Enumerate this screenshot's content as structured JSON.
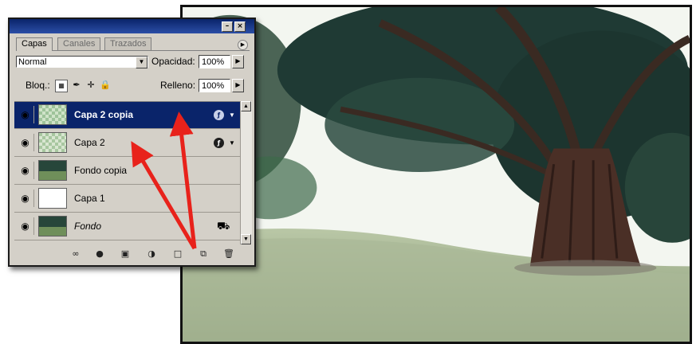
{
  "palette": {
    "title_buttons": [
      "–",
      "×"
    ],
    "tabs": [
      {
        "label": "Capas",
        "active": true
      },
      {
        "label": "Canales",
        "active": false
      },
      {
        "label": "Trazados",
        "active": false
      }
    ],
    "blend_mode": "Normal",
    "opacity_label": "Opacidad:",
    "opacity_value": "100%",
    "lock_label": "Bloq.:",
    "fill_label": "Relleno:",
    "fill_value": "100%",
    "layers": [
      {
        "name": "Capa 2 copia",
        "selected": true,
        "thumb": "checker-green",
        "badge": "fx",
        "italic": false
      },
      {
        "name": "Capa 2",
        "selected": false,
        "thumb": "checker-green",
        "badge": "fx",
        "italic": false
      },
      {
        "name": "Fondo copia",
        "selected": false,
        "thumb": "photo",
        "badge": "",
        "italic": false
      },
      {
        "name": "Capa 1",
        "selected": false,
        "thumb": "white",
        "badge": "",
        "italic": false
      },
      {
        "name": "Fondo",
        "selected": false,
        "thumb": "photo",
        "badge": "lock",
        "italic": true
      }
    ],
    "bottom_icons": [
      "link-icon",
      "layer-style-icon",
      "mask-icon",
      "adjustment-icon",
      "group-icon",
      "new-layer-icon",
      "trash-icon"
    ]
  },
  "colors": {
    "titlebar": "#0a246a",
    "selection": "#0a246a",
    "arrow": "#e8221b",
    "panel": "#d4d0c8"
  }
}
